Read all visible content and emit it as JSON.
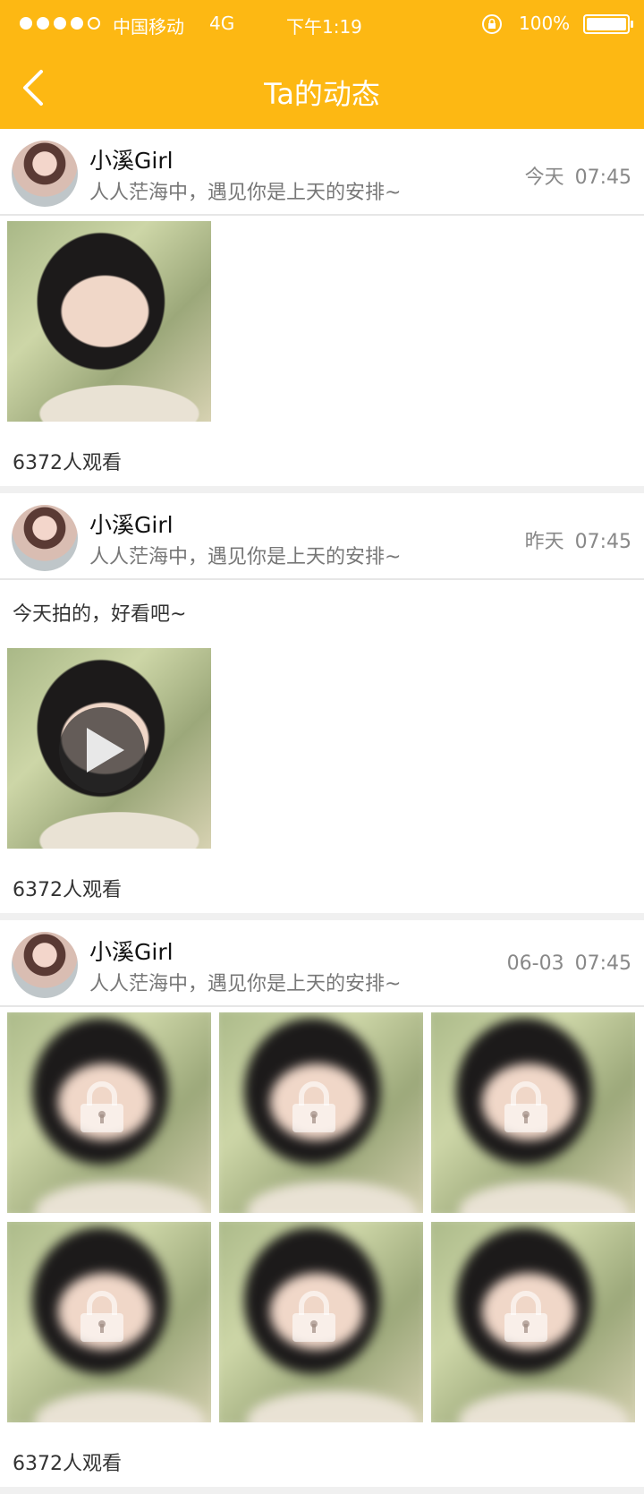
{
  "status_bar": {
    "carrier": "中国移动",
    "network": "4G",
    "time": "下午1:19",
    "battery": "100%",
    "signal_strength": 4,
    "signal_max": 5
  },
  "nav": {
    "title": "Ta的动态",
    "back_icon": "chevron-left-icon"
  },
  "colors": {
    "accent": "#fdb813"
  },
  "posts": [
    {
      "username": "小溪Girl",
      "signature": "人人茫海中，遇见你是上天的安排~",
      "day": "今天",
      "time": "07:45",
      "caption": "",
      "media_type": "photo",
      "views": "6372人观看"
    },
    {
      "username": "小溪Girl",
      "signature": "人人茫海中，遇见你是上天的安排~",
      "day": "昨天",
      "time": "07:45",
      "caption": "今天拍的，好看吧~",
      "media_type": "video",
      "views": "6372人观看"
    },
    {
      "username": "小溪Girl",
      "signature": "人人茫海中，遇见你是上天的安排~",
      "day": "06-03",
      "time": "07:45",
      "caption": "",
      "media_type": "locked-photos",
      "locked_count": 6,
      "views": "6372人观看"
    }
  ]
}
